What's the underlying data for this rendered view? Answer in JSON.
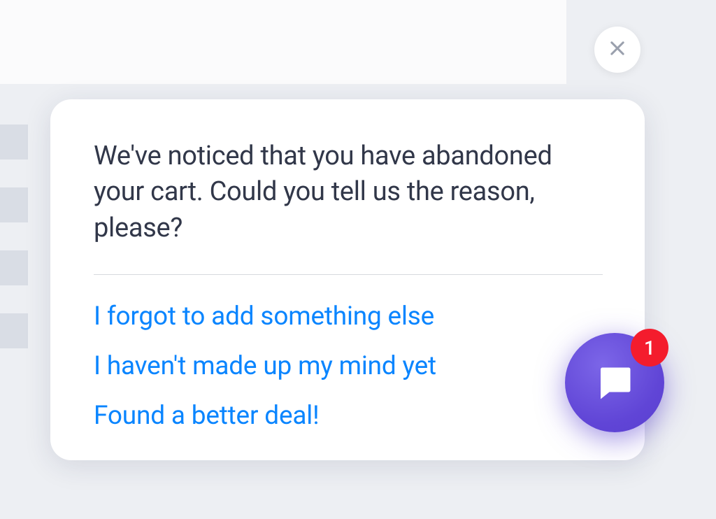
{
  "popup": {
    "message": "We've noticed that you have abandoned your cart. Could you tell us the reason, please?",
    "options": [
      "I forgot to add something else",
      "I haven't made up my mind yet",
      "Found a better deal!"
    ]
  },
  "chat": {
    "badge_count": "1"
  },
  "colors": {
    "link": "#0a85ff",
    "text": "#313749",
    "fab": "#6045d6",
    "badge": "#f41c2d"
  }
}
